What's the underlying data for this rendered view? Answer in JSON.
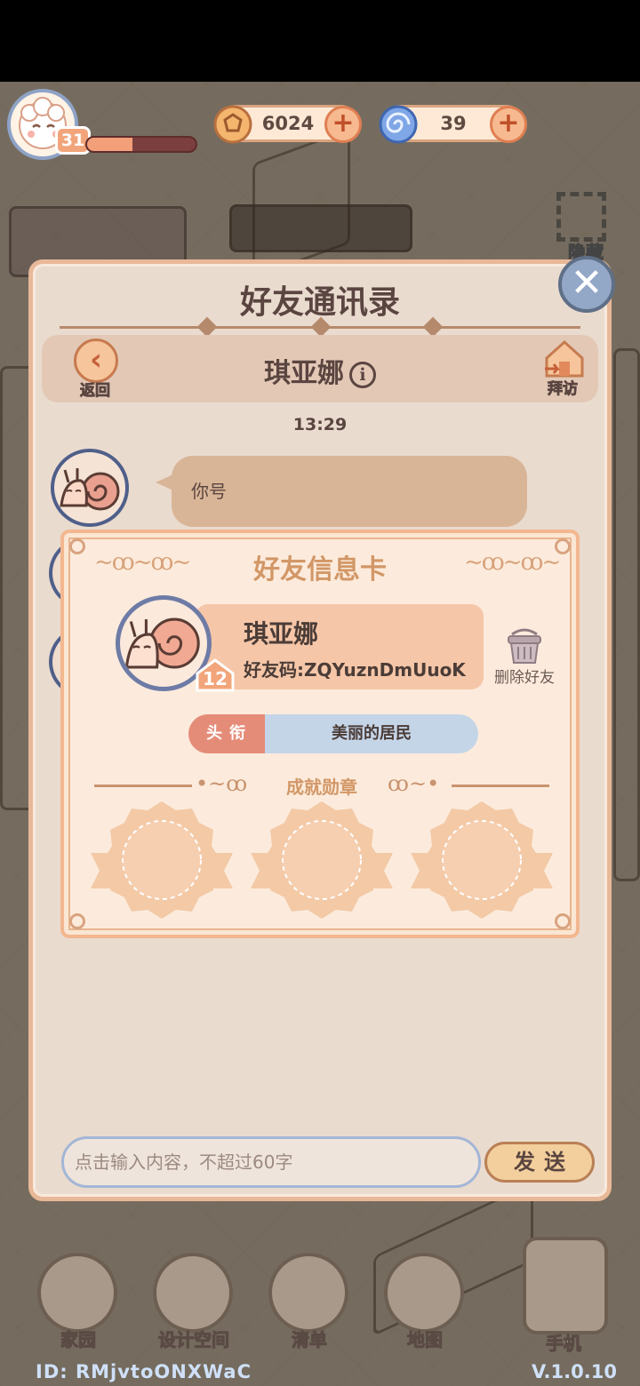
{
  "hud": {
    "level": "31",
    "exp_progress": 0.42,
    "coins": "6024",
    "gems": "39",
    "hide_label": "隐藏"
  },
  "friends_panel": {
    "title": "好友通讯录",
    "back_label": "返回",
    "visit_label": "拜访",
    "friend_name": "琪亚娜",
    "info_icon": "i",
    "chat_time": "13:29",
    "message_text": "你号",
    "input_placeholder": "点击输入内容，不超过60字",
    "input_value": "",
    "send_label": "发送"
  },
  "friend_card": {
    "title": "好友信息卡",
    "name": "琪亚娜",
    "friend_code": "好友码:ZQYuznDmUuoK",
    "level": "12",
    "delete_label": "删除好友",
    "title_key": "头衔",
    "title_value": "美丽的居民",
    "badges_label": "成就勋章",
    "badges": [
      "",
      "",
      ""
    ]
  },
  "bottom_nav": {
    "items": [
      {
        "label": "家园",
        "icon": "home-icon"
      },
      {
        "label": "设计空间",
        "icon": "design-icon"
      },
      {
        "label": "清单",
        "icon": "list-icon"
      },
      {
        "label": "地图",
        "icon": "map-pin-icon"
      },
      {
        "label": "手机",
        "icon": "phone-icon"
      }
    ]
  },
  "footer": {
    "user_id": "ID: RMjvtoONXWaC",
    "version": "V.1.0.10"
  },
  "colors": {
    "panel_bg": "#eadbcf",
    "card_bg": "#fcebdc",
    "accent_orange": "#f2a57a",
    "accent_blue": "#93a7c7",
    "title_key_bg": "#e58c79",
    "title_value_bg": "#c5d5e8"
  }
}
